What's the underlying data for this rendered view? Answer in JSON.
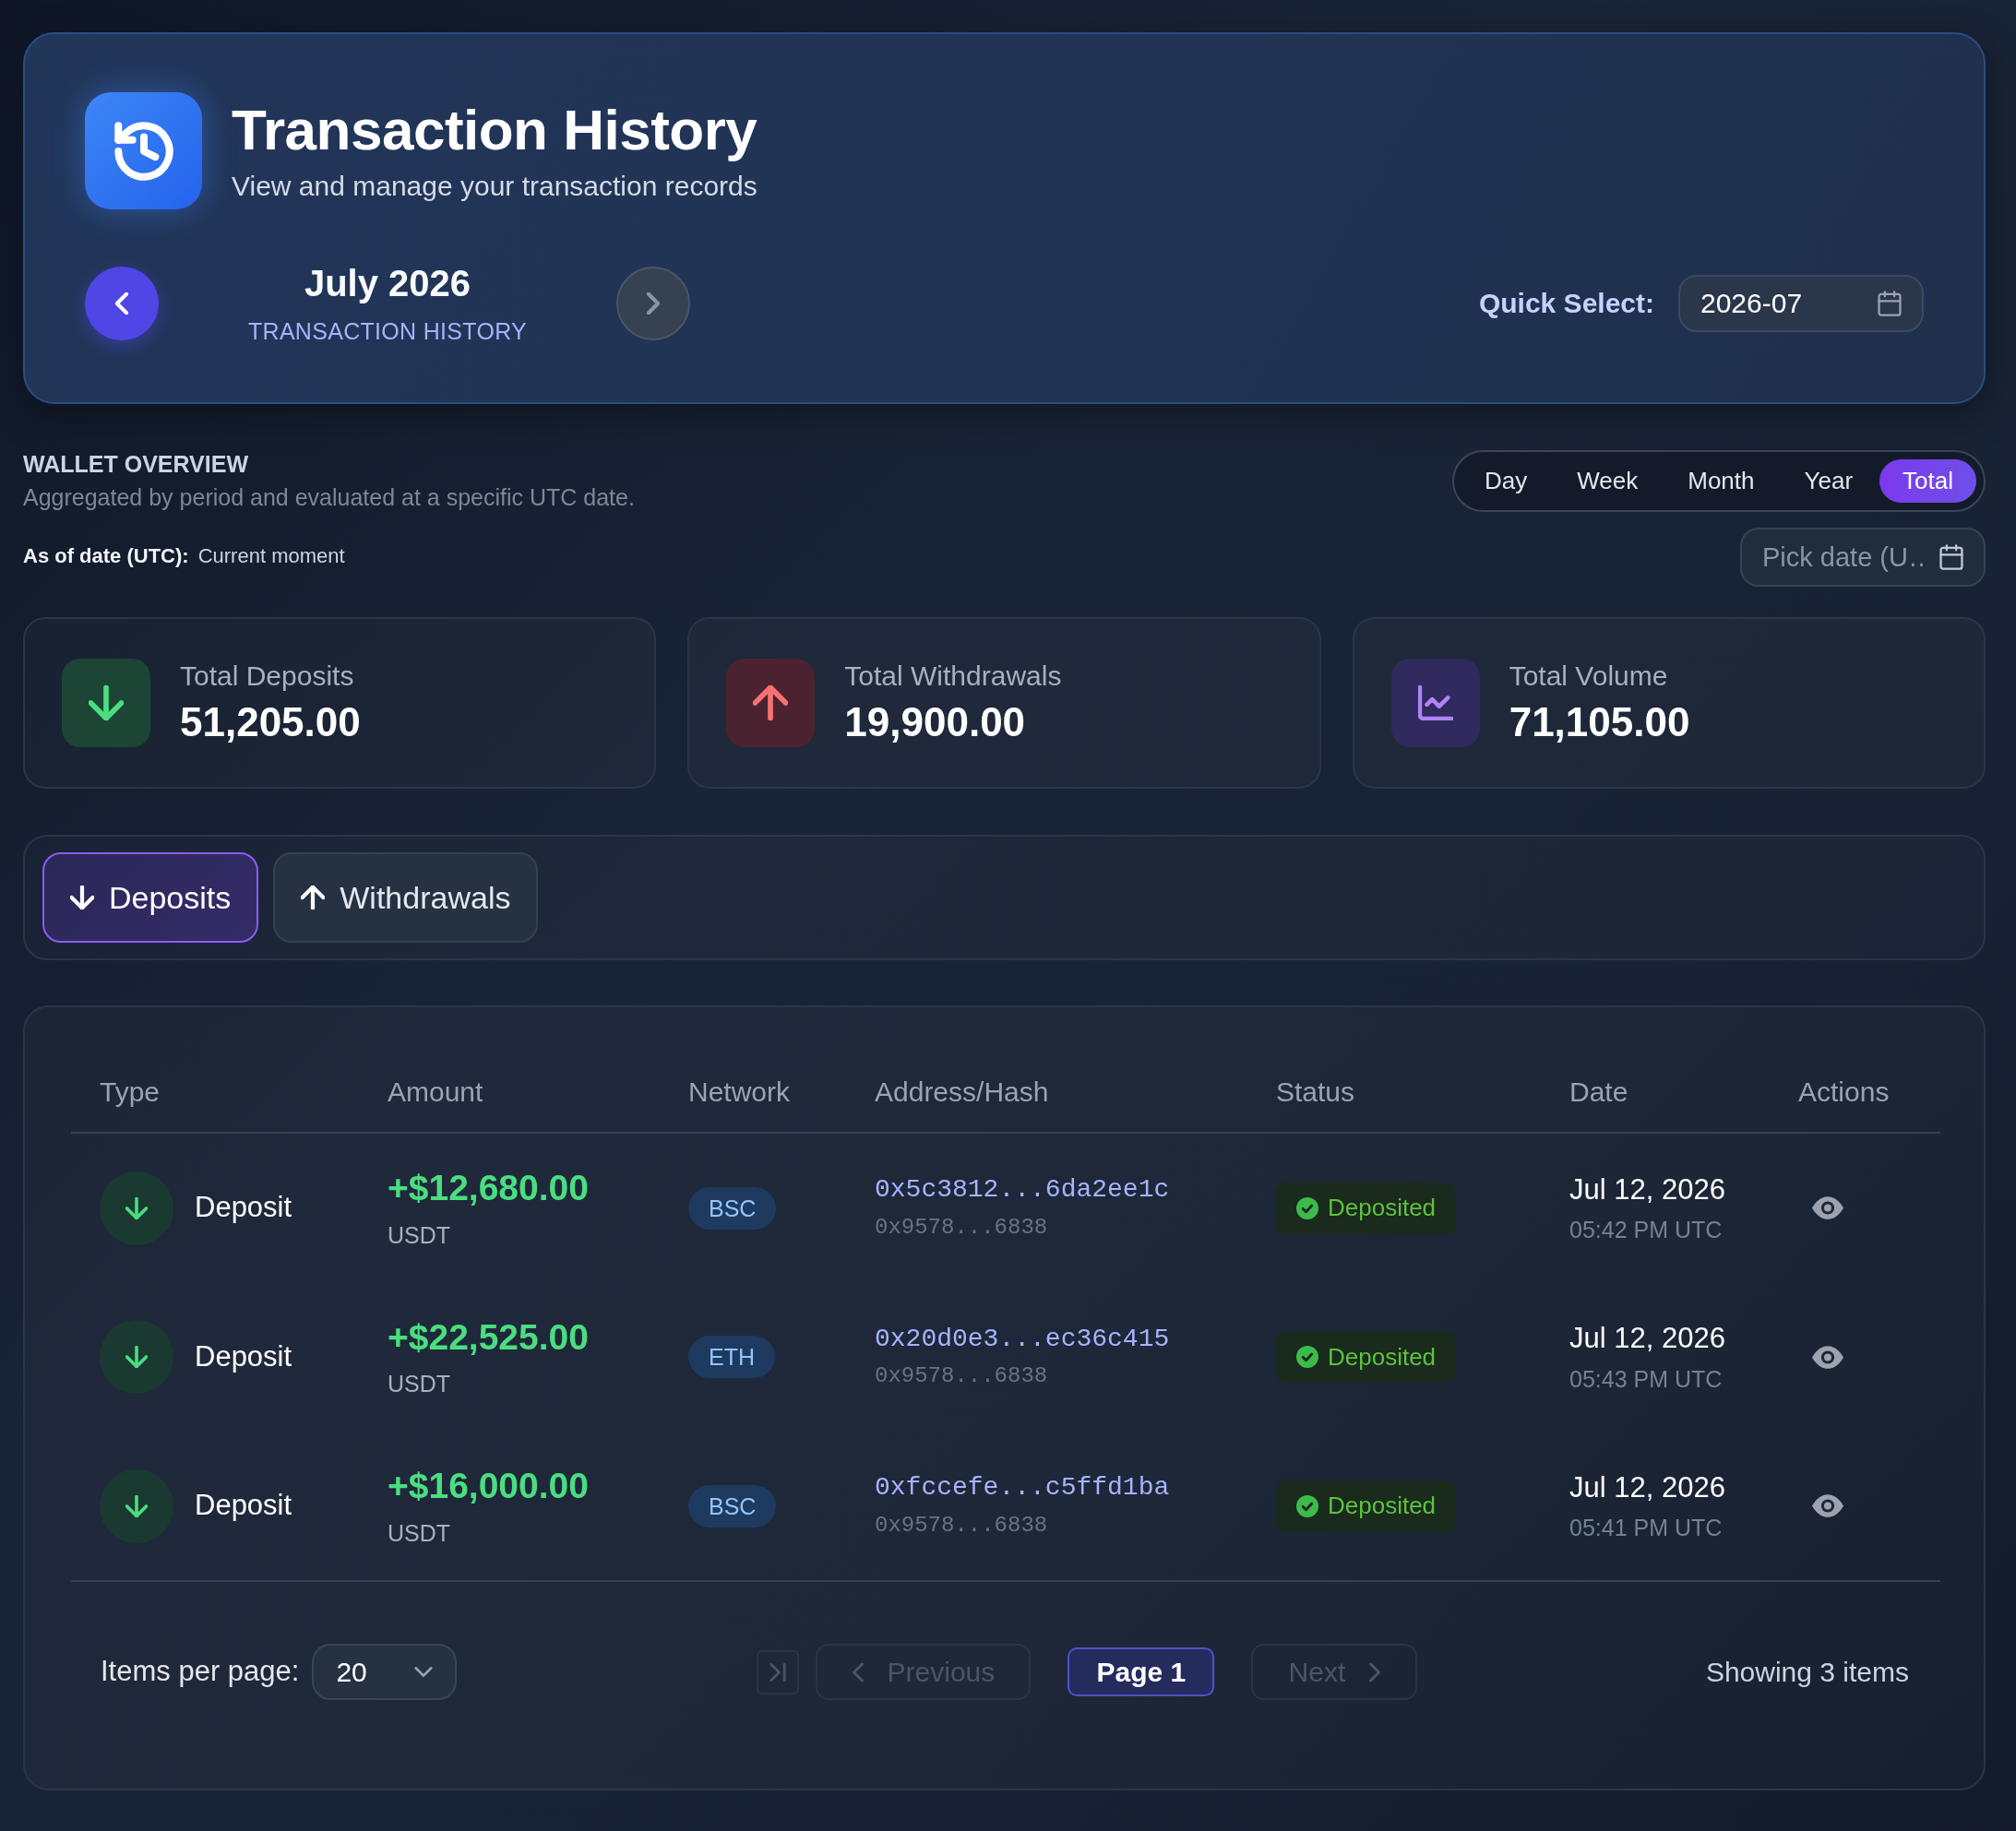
{
  "header": {
    "title": "Transaction History",
    "subtitle": "View and manage your transaction records",
    "month": "July 2026",
    "month_caption": "TRANSACTION HISTORY",
    "prev_month": {
      "disabled": false
    },
    "next_month": {
      "disabled": true
    },
    "quick_select": {
      "label": "Quick Select:",
      "value": "2026-07"
    }
  },
  "overview": {
    "title": "WALLET OVERVIEW",
    "subtitle": "Aggregated by period and evaluated at a specific UTC date.",
    "as_of_label": "As of date (UTC):",
    "as_of_value": "Current moment",
    "periods": [
      {
        "label": "Day",
        "selected": false
      },
      {
        "label": "Week",
        "selected": false
      },
      {
        "label": "Month",
        "selected": false
      },
      {
        "label": "Year",
        "selected": false
      },
      {
        "label": "Total",
        "selected": true
      }
    ],
    "date_picker": {
      "placeholder": "Pick date (U…"
    }
  },
  "stats": [
    {
      "kind": "deposits",
      "label": "Total Deposits",
      "value": "51,205.00"
    },
    {
      "kind": "withdrawals",
      "label": "Total Withdrawals",
      "value": "19,900.00"
    },
    {
      "kind": "volume",
      "label": "Total Volume",
      "value": "71,105.00"
    }
  ],
  "tabs": [
    {
      "kind": "deposit",
      "label": "Deposits",
      "selected": true
    },
    {
      "kind": "withdrawal",
      "label": "Withdrawals",
      "selected": false
    }
  ],
  "table": {
    "columns": [
      "Type",
      "Amount",
      "Network",
      "Address/Hash",
      "Status",
      "Date",
      "Actions"
    ],
    "rows": [
      {
        "kind": "deposit",
        "type": "Deposit",
        "amount": "+$12,680.00",
        "currency": "USDT",
        "network": "BSC",
        "hash": "0x5c3812...6da2ee1c",
        "address": "0x9578...6838",
        "status": "Deposited",
        "date": "Jul 12, 2026",
        "time": "05:42 PM UTC"
      },
      {
        "kind": "deposit",
        "type": "Deposit",
        "amount": "+$22,525.00",
        "currency": "USDT",
        "network": "ETH",
        "hash": "0x20d0e3...ec36c415",
        "address": "0x9578...6838",
        "status": "Deposited",
        "date": "Jul 12, 2026",
        "time": "05:43 PM UTC"
      },
      {
        "kind": "deposit",
        "type": "Deposit",
        "amount": "+$16,000.00",
        "currency": "USDT",
        "network": "BSC",
        "hash": "0xfccefe...c5ffd1ba",
        "address": "0x9578...6838",
        "status": "Deposited",
        "date": "Jul 12, 2026",
        "time": "05:41 PM UTC"
      }
    ]
  },
  "pagination": {
    "per_page_label": "Items per page:",
    "per_page": "20",
    "first_page": {
      "disabled": true
    },
    "previous": {
      "label": "Previous",
      "disabled": true
    },
    "page": "Page 1",
    "next": {
      "label": "Next",
      "disabled": true
    },
    "summary": "Showing 3 items"
  }
}
